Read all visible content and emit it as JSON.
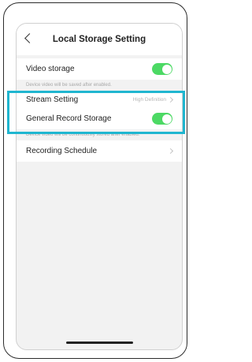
{
  "header": {
    "title": "Local Storage Setting"
  },
  "settings": {
    "video_storage": {
      "label": "Video storage",
      "hint": "Device video will be saved after enabled.",
      "enabled": true
    },
    "stream_setting": {
      "label": "Stream Setting",
      "value": "High Definition"
    },
    "general_record_storage": {
      "label": "General Record Storage",
      "hint": "Device video will be continuously stored after enabled.",
      "enabled": true
    },
    "recording_schedule": {
      "label": "Recording Schedule"
    }
  },
  "colors": {
    "toggle_on": "#4cd964",
    "highlight": "#20b6d0"
  }
}
